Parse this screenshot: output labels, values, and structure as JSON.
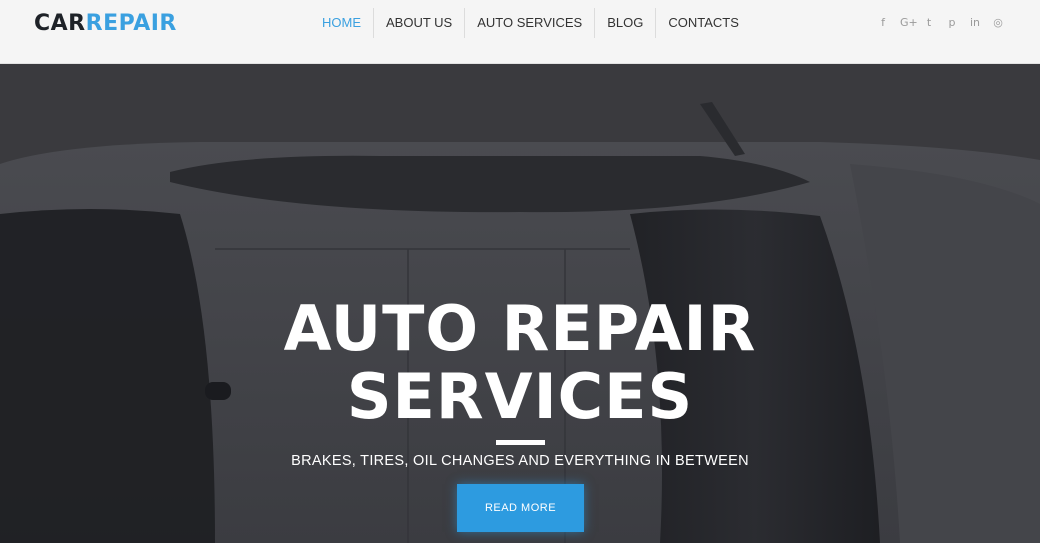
{
  "brand": {
    "logo_part1": "CAR",
    "logo_part2": "REPAIR"
  },
  "nav": {
    "items": [
      {
        "label": "HOME",
        "active": true
      },
      {
        "label": "ABOUT US",
        "active": false
      },
      {
        "label": "AUTO SERVICES",
        "active": false
      },
      {
        "label": "BLOG",
        "active": false
      },
      {
        "label": "CONTACTS",
        "active": false
      }
    ]
  },
  "social": [
    {
      "icon": "facebook-icon",
      "glyph": "f"
    },
    {
      "icon": "google-plus-icon",
      "glyph": "G+"
    },
    {
      "icon": "twitter-icon",
      "glyph": "t"
    },
    {
      "icon": "pinterest-icon",
      "glyph": "p"
    },
    {
      "icon": "linkedin-icon",
      "glyph": "in"
    },
    {
      "icon": "instagram-icon",
      "glyph": "◎"
    }
  ],
  "hero": {
    "title_line1": "AUTO REPAIR",
    "title_line2": "SERVICES",
    "subtitle": "BRAKES, TIRES, OIL CHANGES AND EVERYTHING IN BETWEEN",
    "cta_label": "READ MORE"
  },
  "colors": {
    "accent": "#3aa0e0",
    "button": "#2d9be0",
    "hero_overlay": "#3a3a3e",
    "text_dark": "#1e2228"
  }
}
